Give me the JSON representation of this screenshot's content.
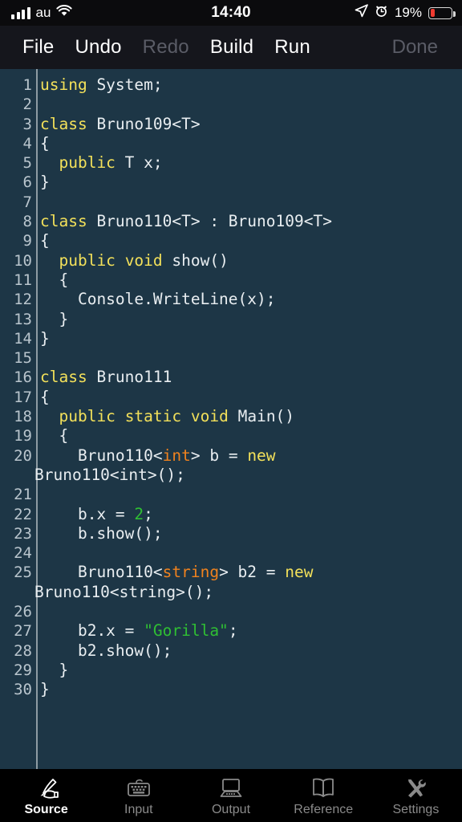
{
  "statusbar": {
    "carrier": "au",
    "signal_icon": "signal-bars-icon",
    "wifi_icon": "wifi-icon",
    "time": "14:40",
    "location_icon": "location-arrow-icon",
    "alarm_icon": "alarm-clock-icon",
    "battery_percent": "19%",
    "battery_icon": "battery-icon",
    "battery_level": 19,
    "battery_color": "#f03b30"
  },
  "toolbar": {
    "file_label": "File",
    "undo_label": "Undo",
    "redo_label": "Redo",
    "build_label": "Build",
    "run_label": "Run",
    "done_label": "Done"
  },
  "editor": {
    "background": "#1d3646",
    "keyword_color": "#f2e05a",
    "type_color": "#f0821e",
    "string_color": "#2fbf33",
    "text_color": "#e9eef1",
    "lineno_color": "#b9c5cd",
    "lines": [
      {
        "n": "1",
        "html": "<span class=\"kw\">using</span> System;"
      },
      {
        "n": "2",
        "html": ""
      },
      {
        "n": "3",
        "html": "<span class=\"kw\">class</span> Bruno109&lt;T&gt;"
      },
      {
        "n": "4",
        "html": "{"
      },
      {
        "n": "5",
        "html": "  <span class=\"kw\">public</span> T x;"
      },
      {
        "n": "6",
        "html": "}"
      },
      {
        "n": "7",
        "html": ""
      },
      {
        "n": "8",
        "html": "<span class=\"kw\">class</span> Bruno110&lt;T&gt; : Bruno109&lt;T&gt;"
      },
      {
        "n": "9",
        "html": "{"
      },
      {
        "n": "10",
        "html": "  <span class=\"kw\">public</span> <span class=\"kw\">void</span> show()"
      },
      {
        "n": "11",
        "html": "  {"
      },
      {
        "n": "12",
        "html": "    Console.WriteLine(x);"
      },
      {
        "n": "13",
        "html": "  }"
      },
      {
        "n": "14",
        "html": "}"
      },
      {
        "n": "15",
        "html": ""
      },
      {
        "n": "16",
        "html": "<span class=\"kw\">class</span> Bruno111"
      },
      {
        "n": "17",
        "html": "{"
      },
      {
        "n": "18",
        "html": "  <span class=\"kw\">public</span> <span class=\"kw\">static</span> <span class=\"kw\">void</span> Main()"
      },
      {
        "n": "19",
        "html": "  {"
      },
      {
        "n": "20",
        "html": "    Bruno110&lt;<span class=\"typ\">int</span>&gt; b = <span class=\"kw\">new</span>",
        "cont": "Bruno110&lt;<span class=\"typ\">int</span>&gt;();"
      },
      {
        "n": "21",
        "html": ""
      },
      {
        "n": "22",
        "html": "    b.x = <span class=\"num\">2</span>;"
      },
      {
        "n": "23",
        "html": "    b.show();"
      },
      {
        "n": "24",
        "html": ""
      },
      {
        "n": "25",
        "html": "    Bruno110&lt;<span class=\"typ\">string</span>&gt; b2 = <span class=\"kw\">new</span>",
        "cont": "Bruno110&lt;<span class=\"typ\">string</span>&gt;();"
      },
      {
        "n": "26",
        "html": ""
      },
      {
        "n": "27",
        "html": "    b2.x = <span class=\"str\">\"Gorilla\"</span>;"
      },
      {
        "n": "28",
        "html": "    b2.show();"
      },
      {
        "n": "29",
        "html": "  }"
      },
      {
        "n": "30",
        "html": "}"
      }
    ]
  },
  "tabbar": {
    "items": [
      {
        "label": "Source",
        "icon": "hand-writing-pen-icon",
        "active": true
      },
      {
        "label": "Input",
        "icon": "keyboard-icon",
        "active": false
      },
      {
        "label": "Output",
        "icon": "computer-monitor-icon",
        "active": false
      },
      {
        "label": "Reference",
        "icon": "open-book-icon",
        "active": false
      },
      {
        "label": "Settings",
        "icon": "tools-wrench-icon",
        "active": false
      }
    ]
  }
}
